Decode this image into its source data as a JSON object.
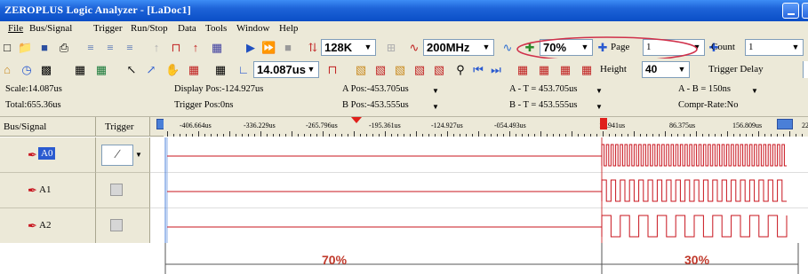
{
  "window": {
    "title": "ZEROPLUS Logic Analyzer - [LaDoc1]"
  },
  "menu": [
    "File",
    "Bus/Signal",
    "Trigger",
    "Run/Stop",
    "Data",
    "Tools",
    "Window",
    "Help"
  ],
  "toolbar1": {
    "memory_value": "128K",
    "frequency_value": "200MHz",
    "zoom_value": "70%",
    "page_label": "Page",
    "page_value": "1",
    "count_label": "Count",
    "count_value": "1"
  },
  "toolbar2": {
    "scale_value": "14.087us",
    "height_label": "Height",
    "height_value": "40",
    "trigger_delay_label": "Trigger Delay"
  },
  "info": {
    "scale": "Scale:14.087us",
    "total": "Total:655.36us",
    "display_pos": "Display Pos:-124.927us",
    "trigger_pos": "Trigger Pos:0ns",
    "a_pos": "A Pos:-453.705us",
    "b_pos": "B Pos:-453.555us",
    "a_minus_t": "A - T = 453.705us",
    "b_minus_t": "B - T = 453.555us",
    "a_minus_b": "A - B = 150ns",
    "compr_rate": "Compr-Rate:No"
  },
  "header": {
    "bus_signal": "Bus/Signal",
    "trigger": "Trigger",
    "ruler_labels": [
      "-406.664us",
      "-336.229us",
      "-265.796us",
      "-195.361us",
      "-124.927us",
      "-054.493us",
      "15.941us",
      "86.375us",
      "156.809us",
      "22"
    ]
  },
  "signals": [
    {
      "name": "A0"
    },
    {
      "name": "A1"
    },
    {
      "name": "A2"
    }
  ],
  "annotation": {
    "left_percent": "70%",
    "right_percent": "30%"
  },
  "colors": {
    "titlebar": "#0a4ec6",
    "chrome": "#ece9d8",
    "signal_line": "#c8141e",
    "annotation_text": "#c0392b",
    "highlight_ellipse": "#d0304a",
    "cursor_blue": "#4a7fd8",
    "trigger_red": "#e0201b"
  }
}
